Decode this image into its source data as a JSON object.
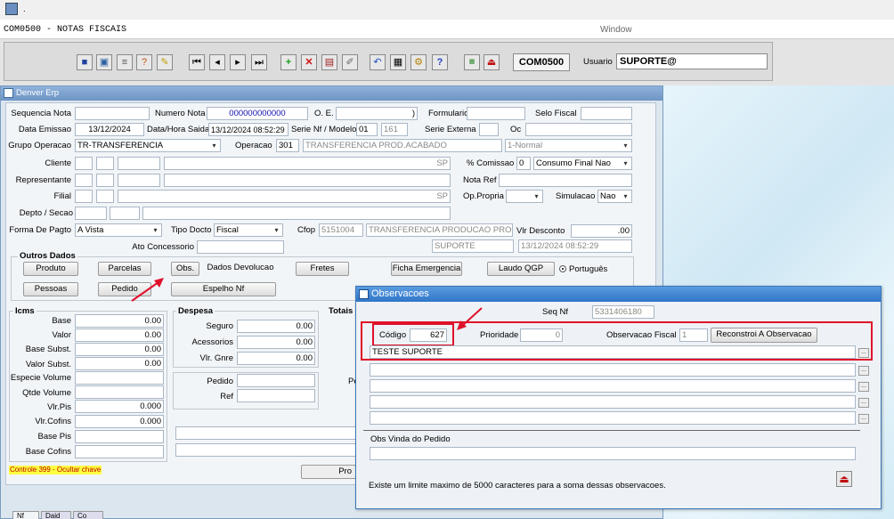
{
  "app": {
    "top_title": ".",
    "module": "COM0500 - NOTAS FISCAIS",
    "window_menu": "Window",
    "module_code": "COM0500",
    "usuario_label": "Usuario",
    "usuario": "SUPORTE@"
  },
  "main": {
    "title": "Denver Erp",
    "sequencia_nota_label": "Sequencia Nota",
    "numero_nota_label": "Numero Nota",
    "numero_nota": "000000000000",
    "oe_label": "O. E.",
    "oe_value": ")",
    "formulario_label": "Formulario",
    "selo_fiscal_label": "Selo Fiscal",
    "data_emissao_label": "Data Emissao",
    "data_emissao": "13/12/2024",
    "data_hora_saida_label": "Data/Hora Saida",
    "data_hora_saida": "13/12/2024 08:52:29",
    "serie_modelo_label": "Serie Nf / Modelo",
    "serie": "01",
    "modelo": "161",
    "serie_externa_label": "Serie Externa",
    "oc_label": "Oc",
    "grupo_operacao_label": "Grupo Operacao",
    "grupo_operacao": "TR-TRANSFERENCIA",
    "operacao_label": "Operacao",
    "operacao_code": "301",
    "operacao_desc": "TRANSFERENCIA PROD.ACABADO",
    "operacao_tipo": "1-Normal",
    "cliente_label": "Cliente",
    "sp1": "SP",
    "comissao_label": "% Comissao",
    "comissao": "0",
    "consumo": "Consumo Final Nao",
    "representante_label": "Representante",
    "nota_ref_label": "Nota Ref",
    "filial_label": "Filial",
    "sp2": "SP",
    "op_propria_label": "Op.Propria",
    "simulacao_label": "Simulacao",
    "simulacao": "Nao",
    "depto_label": "Depto / Secao",
    "forma_pagto_label": "Forma De Pagto",
    "forma_pagto": "A Vista",
    "tipo_docto_label": "Tipo Docto",
    "tipo_docto": "Fiscal",
    "cfop_label": "Cfop",
    "cfop": "5151004",
    "cfop_desc": "TRANSFERENCIA PRODUCAO PROPRIA",
    "vlr_desconto_label": "Vlr Desconto",
    "vlr_desconto": ".00",
    "ato_label": "Ato Concessorio",
    "suporte": "SUPORTE",
    "suporte_data": "13/12/2024 08:52:29",
    "outros_dados_label": "Outros Dados",
    "btn_produto": "Produto",
    "btn_parcelas": "Parcelas",
    "btn_obs": "Obs.",
    "btn_dados_devolucao": "Dados Devolucao",
    "btn_fretes": "Fretes",
    "btn_ficha": "Ficha Emergencia",
    "btn_laudo": "Laudo QGP",
    "portugues": "Português",
    "btn_pessoas": "Pessoas",
    "btn_pedido": "Pedido",
    "btn_espelho": "Espelho Nf",
    "icms_label": "Icms",
    "base_label": "Base",
    "base": "0.00",
    "valor_label": "Valor",
    "valor": "0.00",
    "base_subst_label": "Base Subst.",
    "base_subst": "0.00",
    "valor_subst_label": "Valor Subst.",
    "valor_subst": "0.00",
    "especie_label": "Especie Volume",
    "qtde_label": "Qtde Volume",
    "vlr_pis_label": "Vlr.Pis",
    "vlr_pis": "0.000",
    "vlr_cofins_label": "Vlr.Cofins",
    "vlr_cofins": "0.000",
    "base_pis_label": "Base  Pis",
    "base_cofins_label": "Base  Cofins",
    "despesa_label": "Despesa",
    "seguro_label": "Seguro",
    "seguro": "0.00",
    "acessorios_label": "Acessorios",
    "acessorios": "0.00",
    "vlr_gnre_label": "Vlr. Gnre",
    "vlr_gnre": "0.00",
    "pedido_label": "Pedido",
    "ref_label": "Ref",
    "pe_partial": "Pe",
    "totais_label": "Totais",
    "pro_partial": "Pro",
    "controle": "Controle 399 -  Ocultar chave",
    "tabs": [
      "Nf",
      "Daid",
      "Co"
    ]
  },
  "obs": {
    "title": "Observacoes",
    "seq_nf_label": "Seq Nf",
    "seq_nf": "5331406180",
    "codigo_label": "Código",
    "codigo": "627",
    "prioridade_label": "Prioridade",
    "prioridade": "0",
    "obs_fiscal_label": "Observacao Fiscal",
    "obs_fiscal": "1",
    "reconstroi": "Reconstroi A Observacao",
    "line1": "TESTE SUPORTE",
    "obs_pedido_label": "Obs Vinda do Pedido",
    "limite": "Existe um limite maximo de 5000 caracteres para a soma dessas observacoes."
  }
}
